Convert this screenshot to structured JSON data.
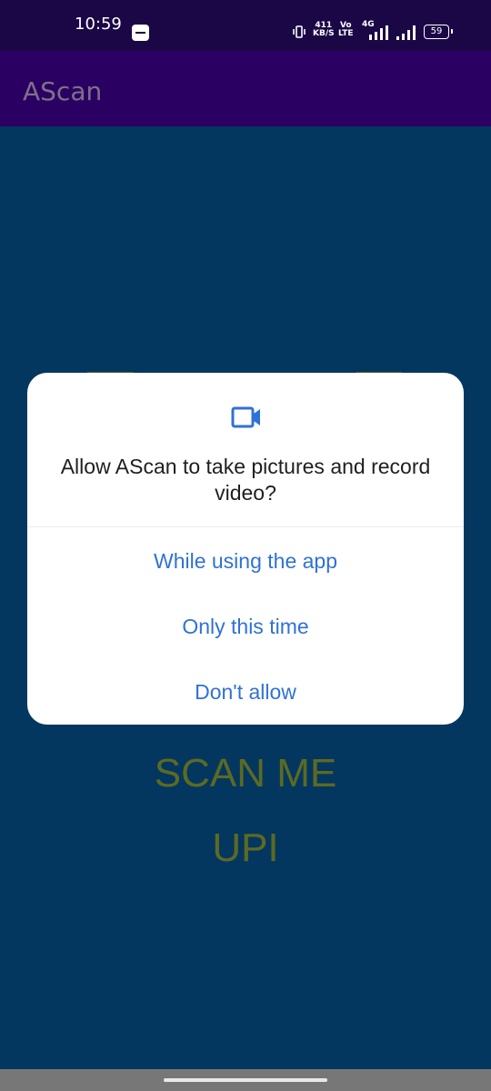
{
  "status_bar": {
    "time": "10:59",
    "net_speed_value": "411",
    "net_speed_unit": "KB/S",
    "volte_top": "Vo",
    "volte_bottom": "LTE",
    "net_type": "4G",
    "battery": "59"
  },
  "app_bar": {
    "title": "AScan"
  },
  "background": {
    "scan_label": "SCAN ME",
    "upi_label": "UPI"
  },
  "dialog": {
    "icon": "camera-video-icon",
    "message": "Allow AScan to take pictures and record video?",
    "options": [
      "While using the app",
      "Only this time",
      "Don't allow"
    ]
  },
  "colors": {
    "accent": "#2f72d6",
    "status_bar": "#1b0746",
    "app_bar": "#2a0163",
    "background": "#04375f"
  }
}
